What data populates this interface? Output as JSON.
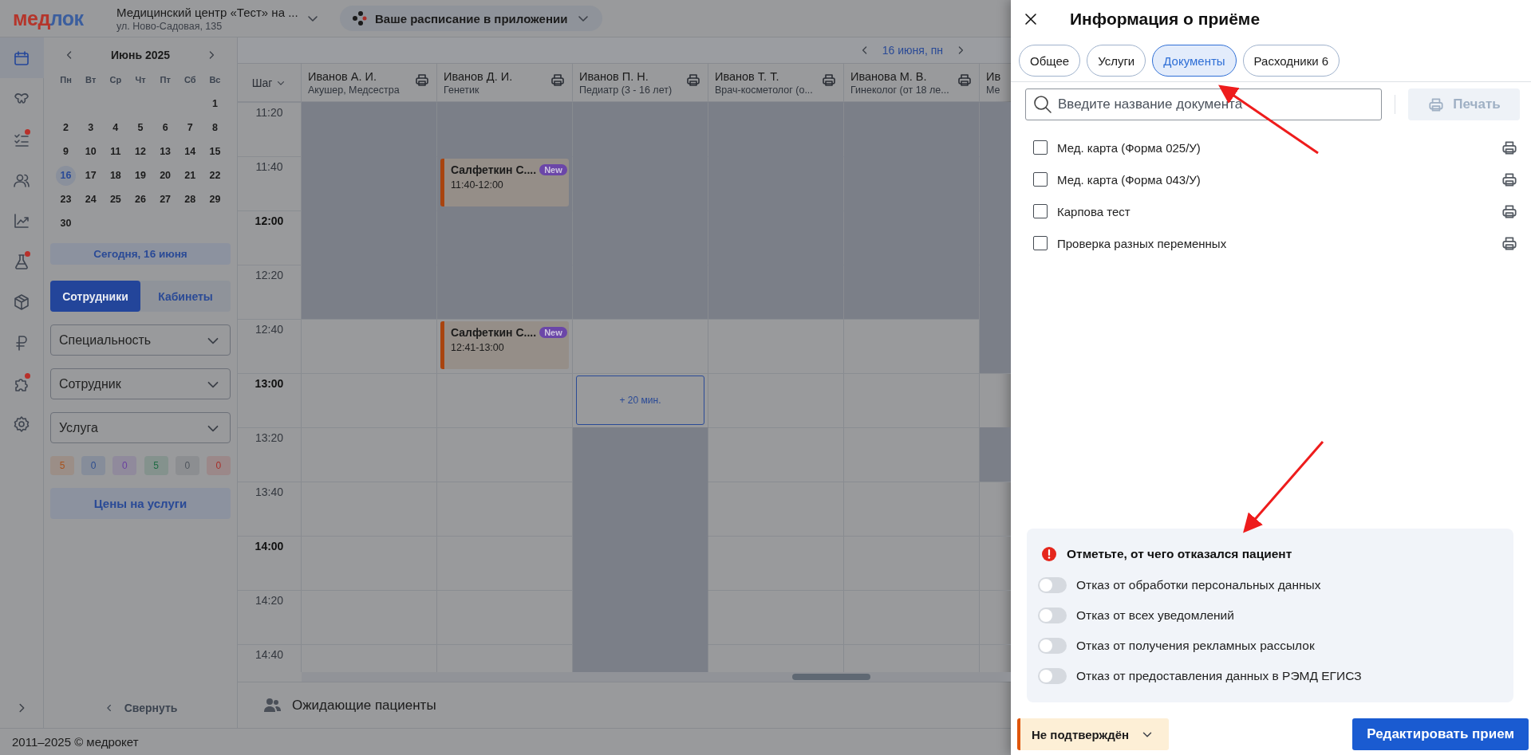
{
  "header": {
    "logo": [
      {
        "text": "мед",
        "color": "#b5352b"
      },
      {
        "text": "лок",
        "color": "#3b5e9e"
      }
    ],
    "clinic": {
      "name": "Медицинский центр «Тест» на ...",
      "address": "ул. Ново-Садовая, 135"
    },
    "app_promo": "Ваше расписание в приложении"
  },
  "rail": {
    "items": [
      {
        "kind": "calendar",
        "selected": true,
        "badge": false
      },
      {
        "kind": "teeth",
        "selected": false,
        "badge": false
      },
      {
        "kind": "checklist",
        "selected": false,
        "badge": true
      },
      {
        "kind": "people",
        "selected": false,
        "badge": false
      },
      {
        "kind": "chart",
        "selected": false,
        "badge": false
      },
      {
        "kind": "flask",
        "selected": false,
        "badge": true
      },
      {
        "kind": "box",
        "selected": false,
        "badge": false
      },
      {
        "kind": "ruble",
        "selected": false,
        "badge": false
      },
      {
        "kind": "puzzle",
        "selected": false,
        "badge": true
      },
      {
        "kind": "gear",
        "selected": false,
        "badge": false
      }
    ]
  },
  "calendar": {
    "month": "Июнь 2025",
    "weekdays": [
      "Пн",
      "Вт",
      "Ср",
      "Чт",
      "Пт",
      "Сб",
      "Вс"
    ],
    "weeks": [
      [
        {
          "kind": "empty"
        },
        {
          "kind": "empty"
        },
        {
          "kind": "empty"
        },
        {
          "kind": "empty"
        },
        {
          "kind": "empty"
        },
        {
          "kind": "empty"
        },
        {
          "kind": "day",
          "day": "1",
          "selected": false
        }
      ],
      [
        {
          "kind": "day",
          "day": "2",
          "selected": false
        },
        {
          "kind": "day",
          "day": "3",
          "selected": false
        },
        {
          "kind": "day",
          "day": "4",
          "selected": false
        },
        {
          "kind": "day",
          "day": "5",
          "selected": false
        },
        {
          "kind": "day",
          "day": "6",
          "selected": false
        },
        {
          "kind": "day",
          "day": "7",
          "selected": false
        },
        {
          "kind": "day",
          "day": "8",
          "selected": false
        }
      ],
      [
        {
          "kind": "day",
          "day": "9",
          "selected": false
        },
        {
          "kind": "day",
          "day": "10",
          "selected": false
        },
        {
          "kind": "day",
          "day": "11",
          "selected": false
        },
        {
          "kind": "day",
          "day": "12",
          "selected": false
        },
        {
          "kind": "day",
          "day": "13",
          "selected": false
        },
        {
          "kind": "day",
          "day": "14",
          "selected": false
        },
        {
          "kind": "day",
          "day": "15",
          "selected": false
        }
      ],
      [
        {
          "kind": "day",
          "day": "16",
          "selected": true
        },
        {
          "kind": "day",
          "day": "17",
          "selected": false
        },
        {
          "kind": "day",
          "day": "18",
          "selected": false
        },
        {
          "kind": "day",
          "day": "19",
          "selected": false
        },
        {
          "kind": "day",
          "day": "20",
          "selected": false
        },
        {
          "kind": "day",
          "day": "21",
          "selected": false
        },
        {
          "kind": "day",
          "day": "22",
          "selected": false
        }
      ],
      [
        {
          "kind": "day",
          "day": "23",
          "selected": false
        },
        {
          "kind": "day",
          "day": "24",
          "selected": false
        },
        {
          "kind": "day",
          "day": "25",
          "selected": false
        },
        {
          "kind": "day",
          "day": "26",
          "selected": false
        },
        {
          "kind": "day",
          "day": "27",
          "selected": false
        },
        {
          "kind": "day",
          "day": "28",
          "selected": false
        },
        {
          "kind": "day",
          "day": "29",
          "selected": false
        }
      ],
      [
        {
          "kind": "day",
          "day": "30",
          "selected": false
        }
      ]
    ],
    "today_button": "Сегодня, 16 июня",
    "view_tabs": [
      {
        "label": "Сотрудники",
        "selected": true
      },
      {
        "label": "Кабинеты",
        "selected": false
      }
    ],
    "filters": [
      {
        "placeholder": "Специальность"
      },
      {
        "placeholder": "Сотрудник"
      },
      {
        "placeholder": "Услуга"
      }
    ],
    "counters": [
      {
        "value": "5",
        "color": "#a8521c"
      },
      {
        "value": "0",
        "color": "#2d4d8f"
      },
      {
        "value": "0",
        "color": "#6a3fa0"
      },
      {
        "value": "5",
        "color": "#1f6b44"
      },
      {
        "value": "0",
        "color": "#4f555d"
      },
      {
        "value": "0",
        "color": "#a82f2a"
      }
    ],
    "prices_button": "Цены на услуги",
    "collapse": "Свернуть"
  },
  "schedule": {
    "date": "16 июня, пн",
    "step_label": "Шаг",
    "columns": [
      {
        "name": "Иванов А. И.",
        "subtitle": "Акушер, Медсестра",
        "print": true
      },
      {
        "name": "Иванов Д. И.",
        "subtitle": "Генетик",
        "print": true
      },
      {
        "name": "Иванов П. Н.",
        "subtitle": "Педиатр (3 - 16 лет)",
        "print": true
      },
      {
        "name": "Иванов Т. Т.",
        "subtitle": "Врач-косметолог (о...",
        "print": true
      },
      {
        "name": "Иванова М. В.",
        "subtitle": "Гинеколог (от 18 ле...",
        "print": true
      },
      {
        "name": "Ив",
        "subtitle": "Ме",
        "print": false
      }
    ],
    "rows": [
      {
        "time": "11:20",
        "bold": false,
        "cells": [
          {
            "blocked": true
          },
          {
            "blocked": true
          },
          {
            "blocked": true
          },
          {
            "blocked": true
          },
          {
            "blocked": true
          },
          {
            "blocked": true
          }
        ]
      },
      {
        "time": "11:40",
        "bold": false,
        "cells": [
          {
            "blocked": true
          },
          {
            "blocked": true,
            "appointment": {
              "name": "Салфеткин С....",
              "time": "11:40-12:00",
              "badge": "New"
            }
          },
          {
            "blocked": true
          },
          {
            "blocked": true
          },
          {
            "blocked": true
          },
          {
            "blocked": true
          }
        ]
      },
      {
        "time": "12:00",
        "bold": true,
        "cells": [
          {
            "blocked": true
          },
          {
            "blocked": true
          },
          {
            "blocked": true
          },
          {
            "blocked": true
          },
          {
            "blocked": true
          },
          {
            "blocked": true
          }
        ]
      },
      {
        "time": "12:20",
        "bold": false,
        "cells": [
          {
            "blocked": true
          },
          {
            "blocked": true
          },
          {
            "blocked": true
          },
          {
            "blocked": true
          },
          {
            "blocked": true
          },
          {
            "blocked": true
          }
        ]
      },
      {
        "time": "12:40",
        "bold": false,
        "cells": [
          {
            "blocked": false
          },
          {
            "blocked": false,
            "appointment": {
              "name": "Салфеткин С....",
              "time": "12:41-13:00",
              "badge": "New"
            }
          },
          {
            "blocked": false
          },
          {
            "blocked": false
          },
          {
            "blocked": false
          },
          {
            "blocked": true
          }
        ]
      },
      {
        "time": "13:00",
        "bold": true,
        "cells": [
          {
            "blocked": false
          },
          {
            "blocked": false
          },
          {
            "blocked": false,
            "add": "+ 20 мин."
          },
          {
            "blocked": false
          },
          {
            "blocked": false
          },
          {
            "blocked": false
          }
        ]
      },
      {
        "time": "13:20",
        "bold": false,
        "cells": [
          {
            "blocked": false
          },
          {
            "blocked": false
          },
          {
            "blocked": true
          },
          {
            "blocked": false
          },
          {
            "blocked": false
          },
          {
            "blocked": true
          }
        ]
      },
      {
        "time": "13:40",
        "bold": false,
        "cells": [
          {
            "blocked": false
          },
          {
            "blocked": false
          },
          {
            "blocked": true
          },
          {
            "blocked": false
          },
          {
            "blocked": false
          },
          {
            "blocked": false
          }
        ]
      },
      {
        "time": "14:00",
        "bold": true,
        "cells": [
          {
            "blocked": false
          },
          {
            "blocked": false
          },
          {
            "blocked": true
          },
          {
            "blocked": false
          },
          {
            "blocked": false
          },
          {
            "blocked": false
          }
        ]
      },
      {
        "time": "14:20",
        "bold": false,
        "cells": [
          {
            "blocked": false
          },
          {
            "blocked": false
          },
          {
            "blocked": true
          },
          {
            "blocked": false
          },
          {
            "blocked": false
          },
          {
            "blocked": false
          }
        ]
      },
      {
        "time": "14:40",
        "bold": false,
        "cells": [
          {
            "blocked": false
          },
          {
            "blocked": false
          },
          {
            "blocked": true
          },
          {
            "blocked": false
          },
          {
            "blocked": false
          },
          {
            "blocked": false
          }
        ]
      }
    ],
    "waiting": "Ожидающие пациенты"
  },
  "footer": "2011–2025 © медрокет",
  "drawer": {
    "title": "Информация о приёме",
    "tabs": [
      {
        "label": "Общее",
        "selected": false
      },
      {
        "label": "Услуги",
        "selected": false
      },
      {
        "label": "Документы",
        "selected": true
      },
      {
        "label": "Расходники 6",
        "selected": false
      }
    ],
    "search": {
      "placeholder": "Введите название документа"
    },
    "print_button": {
      "label": "Печать",
      "disabled": true
    },
    "documents": [
      {
        "name": "Мед. карта (Форма 025/У)",
        "checked": false
      },
      {
        "name": "Мед. карта (Форма 043/У)",
        "checked": false
      },
      {
        "name": "Карпова тест",
        "checked": false
      },
      {
        "name": "Проверка разных переменных",
        "checked": false
      }
    ],
    "refusals": {
      "title": "Отметьте, от чего отказался пациент",
      "items": [
        {
          "label": "Отказ от обработки персональных данных",
          "on": false
        },
        {
          "label": "Отказ от всех уведомлений",
          "on": false
        },
        {
          "label": "Отказ от получения рекламных рассылок",
          "on": false
        },
        {
          "label": "Отказ от предоставления данных в РЭМД ЕГИСЗ",
          "on": false
        }
      ]
    },
    "status": "Не подтверждён",
    "edit_button": "Редактировать прием"
  }
}
